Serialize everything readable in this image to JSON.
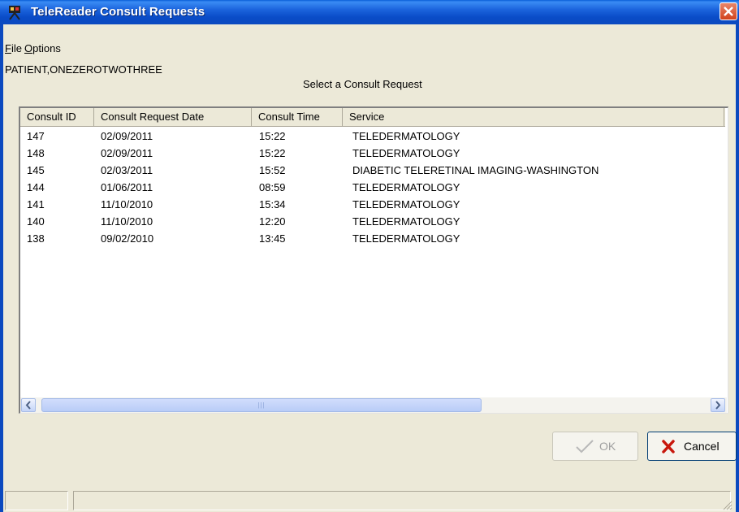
{
  "window": {
    "title": "TeleReader Consult Requests"
  },
  "menu": {
    "file": "File",
    "file_rest": "ile",
    "file_mn": "F",
    "options_mn": "O",
    "options_rest": "ptions"
  },
  "patient_name": "PATIENT,ONEZEROTWOTHREE",
  "instruction": "Select a Consult Request",
  "table": {
    "columns": [
      "Consult ID",
      "Consult Request Date",
      "Consult Time",
      "Service"
    ],
    "rows": [
      [
        "147",
        "02/09/2011",
        "15:22",
        "TELEDERMATOLOGY"
      ],
      [
        "148",
        "02/09/2011",
        "15:22",
        "TELEDERMATOLOGY"
      ],
      [
        "145",
        "02/03/2011",
        "15:52",
        "DIABETIC TELERETINAL IMAGING-WASHINGTON"
      ],
      [
        "144",
        "01/06/2011",
        "08:59",
        "TELEDERMATOLOGY"
      ],
      [
        "141",
        "11/10/2010",
        "15:34",
        "TELEDERMATOLOGY"
      ],
      [
        "140",
        "11/10/2010",
        "12:20",
        "TELEDERMATOLOGY"
      ],
      [
        "138",
        "09/02/2010",
        "13:45",
        "TELEDERMATOLOGY"
      ]
    ]
  },
  "scroll_grip": "|||",
  "buttons": {
    "ok": "OK",
    "cancel": "Cancel"
  },
  "colors": {
    "title_bar": "#0b49bf",
    "window_bg": "#ece9d8",
    "cancel_icon": "#c8170c"
  },
  "icons": {
    "app": "projector-icon",
    "close": "close-icon",
    "ok": "checkmark-icon",
    "cancel": "x-icon"
  }
}
